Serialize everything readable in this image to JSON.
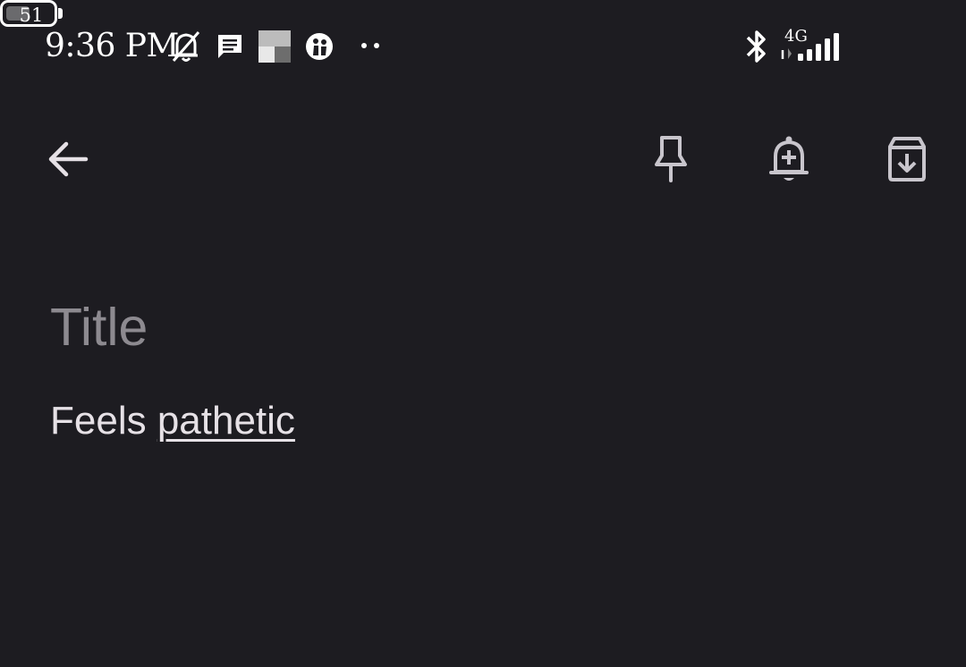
{
  "status_bar": {
    "time": "9:36 PM",
    "network_type": "4G",
    "battery_level": "51",
    "battery_percent": 51,
    "icons": [
      "bell-off-icon",
      "message-icon",
      "app-tile-icon",
      "profile-icon",
      "more-dots-icon",
      "bluetooth-icon",
      "signal-icon",
      "battery-icon"
    ]
  },
  "toolbar": {
    "icons": [
      "back-arrow-icon",
      "pin-icon",
      "add-reminder-icon",
      "archive-icon"
    ]
  },
  "note": {
    "title_placeholder": "Title",
    "title_value": "",
    "body_words": [
      "Feels",
      "pathetic"
    ]
  },
  "colors": {
    "background": "#1d1c21",
    "text": "#e6e1e6",
    "placeholder": "#8d8a90",
    "icon": "#c8c5cc"
  }
}
